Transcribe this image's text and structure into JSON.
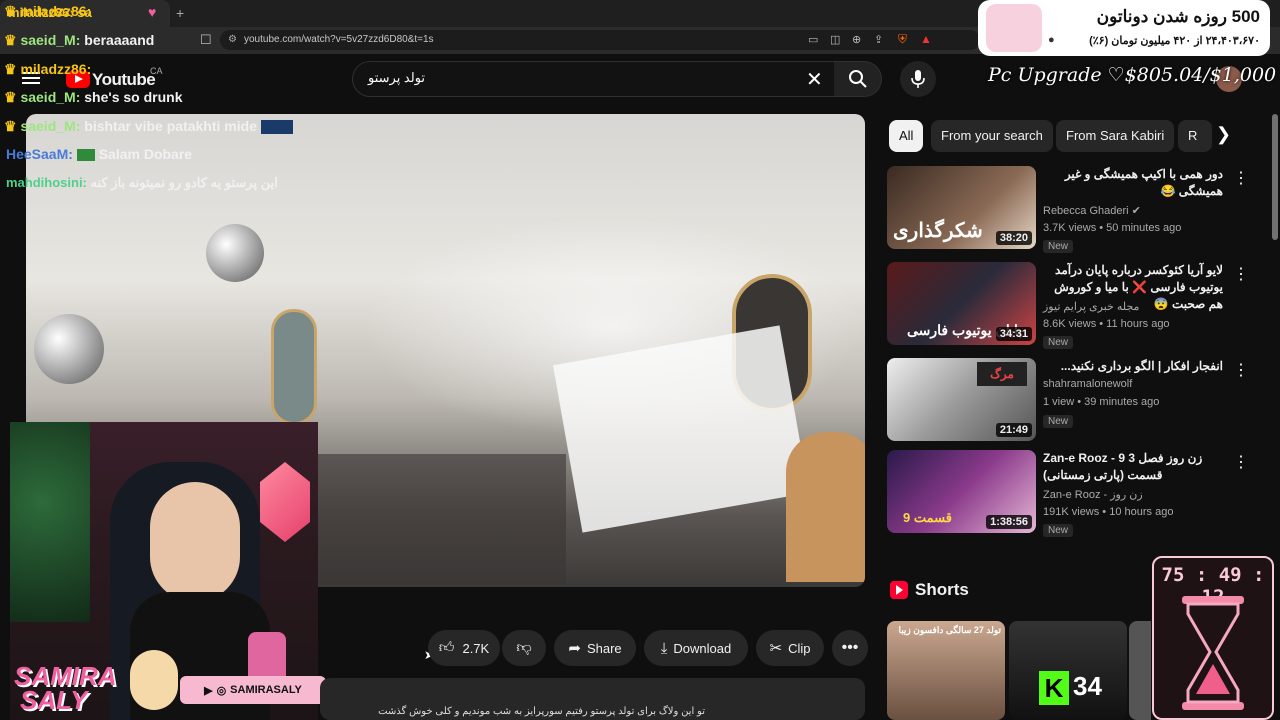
{
  "browser": {
    "tab_title": "miladzz86: sa",
    "url": "youtube.com/watch?v=5v27zzd6D80&t=1s"
  },
  "youtube": {
    "logo_text": "Youtube",
    "country": "CA",
    "search_query": "تولد پرستو",
    "like_count": "2.7K",
    "share_label": "Share",
    "download_label": "Download",
    "clip_label": "Clip",
    "description_snippet": "تو این ولاگ برای تولد پرستو رفتیم سورپرایز به شب موندیم و کلی خوش گذشت"
  },
  "chat": [
    {
      "user": "miladzz86:",
      "msg": "",
      "color": "#f5c518"
    },
    {
      "user": "saeid_M:",
      "msg": "beraaaand",
      "color": "#9ee67f"
    },
    {
      "user": "miladzz86:",
      "msg": "",
      "color": "#f5c518"
    },
    {
      "user": "saeid_M:",
      "msg": "she's so drunk",
      "color": "#9ee67f"
    },
    {
      "user": "saeid_M:",
      "msg": "bishtar vibe patakhti mide",
      "color": "#9ee67f"
    },
    {
      "user": "HeeSaaM:",
      "msg": "Salam Dobare",
      "color": "#4a7bd9"
    },
    {
      "user": "mahdihosini:",
      "msg": "این پرستو یه کادو رو نمیتونه باز کنه",
      "color": "#4fd18a"
    }
  ],
  "donation": {
    "title": "500 روزه شدن دوناتون",
    "subtitle": "۲۴،۴۰۳،۶۷۰ از ۴۲۰ میلیون تومان (۶٪)",
    "goal_text": "Pc Upgrade ♡$805.04/$1,000"
  },
  "chips": [
    "All",
    "From your search",
    "From Sara Kabiri",
    "R"
  ],
  "recommendations": [
    {
      "title": "دور همی با اکیپ همیشگی و غیر همیشگی 😂",
      "channel": "Rebecca Ghaderi",
      "verified": true,
      "meta": "3.7K views • 50 minutes ago",
      "badge": "New",
      "duration": "38:20",
      "thumb_text": "شکرگذاری"
    },
    {
      "title": "لایو آریا کئوکسر درباره پایان درآمد یوتیوب فارسی ❌ با میا و کوروش هم صحبت 😨",
      "channel": "مجله خبری پرایم تیوز",
      "verified": false,
      "meta": "8.6K views • 11 hours ago",
      "badge": "New",
      "duration": "34:31",
      "thumb_text": "پایان یوتیوب فارسی"
    },
    {
      "title": "انفجار افکار | الگو برداری نکنید...",
      "channel": "shahramalonewolf",
      "verified": false,
      "meta": "1 view • 39 minutes ago",
      "badge": "New",
      "duration": "21:49",
      "thumb_text": "مرگ"
    },
    {
      "title": "Zan-e Rooz - 9 زن روز فصل 3 قسمت (پارتی زمستانی)",
      "channel": "Zan-e Rooz - زن روز",
      "verified": false,
      "meta": "191K views • 10 hours ago",
      "badge": "New",
      "duration": "1:38:56",
      "thumb_text": "قسمت 9"
    }
  ],
  "shorts": {
    "label": "Shorts",
    "first_caption": "تولد 27 سالگی دافسون زیبا",
    "counter": "34"
  },
  "streamer": {
    "name_line1": "SAMIRA",
    "name_line2": "SALY",
    "handle": "SAMIRASALY"
  },
  "timer": {
    "value": "75 : 49 : 12"
  },
  "colors": {
    "accent": "#ff0000",
    "chip_active_bg": "#f1f1f1",
    "pink": "#f05fa0"
  }
}
